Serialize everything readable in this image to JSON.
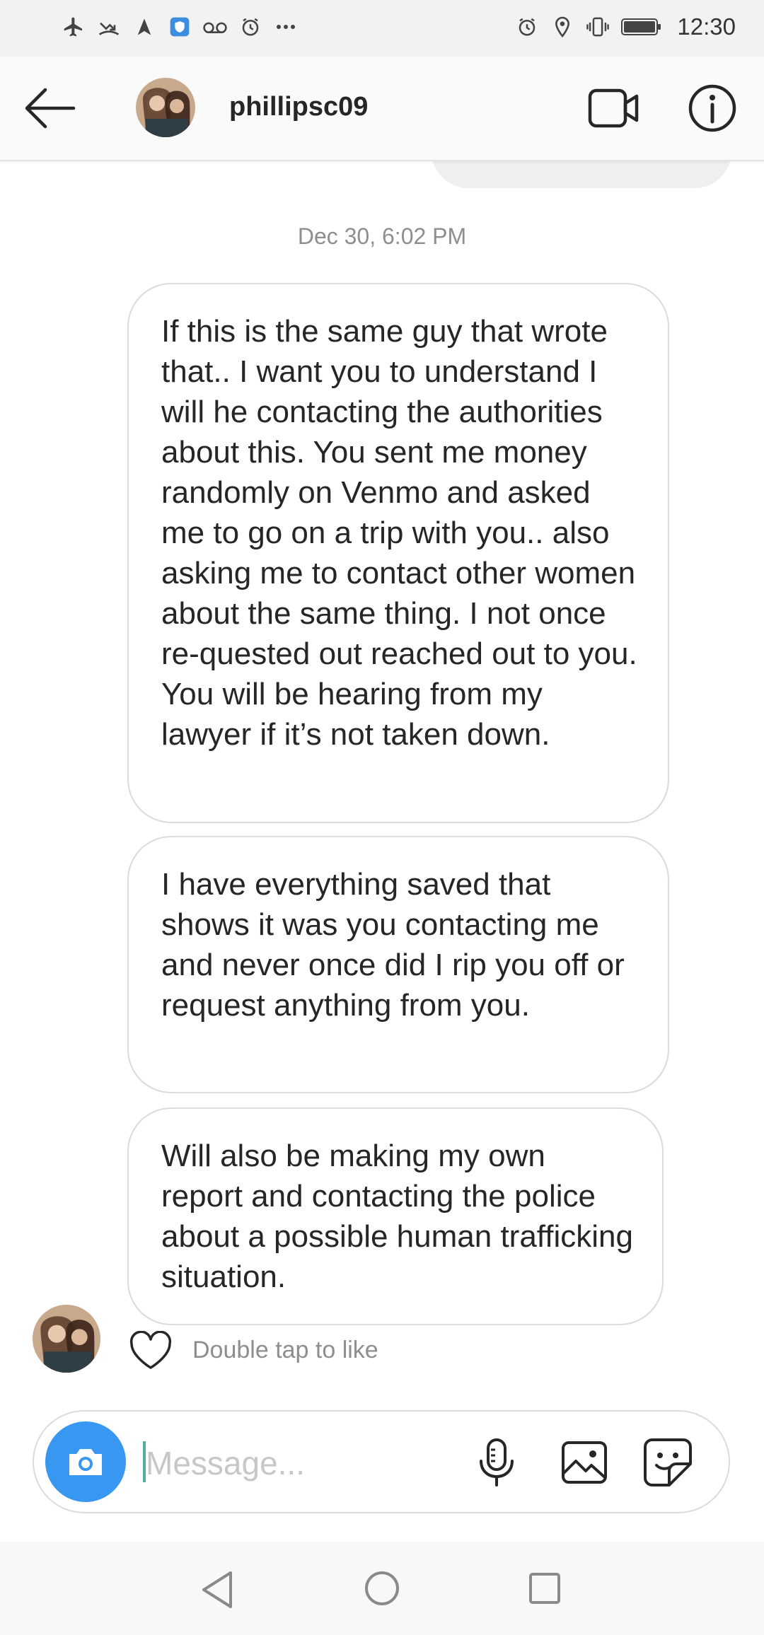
{
  "status_bar": {
    "time": "12:30",
    "left_icons": [
      "airplane-icon",
      "missed-call-icon",
      "navigation-icon",
      "shield-icon",
      "voicemail-icon",
      "alarm-icon",
      "more-icon"
    ],
    "right_icons": [
      "alarm-icon",
      "location-icon",
      "vibrate-icon",
      "battery-icon"
    ]
  },
  "header": {
    "username": "phillipsc09",
    "icons": [
      "back-arrow-icon",
      "video-call-icon",
      "info-icon"
    ]
  },
  "thread": {
    "timestamp": "Dec 30, 6:02 PM",
    "messages": [
      {
        "text": "If this is the same guy that wrote that.. I want you to understand I will he contacting the authorities about this. You sent me money randomly on Venmo and asked me to go on a trip with you.. also asking me to contact other women about the same thing. I not once re-quested out reached out to you. You will be hearing from my lawyer if it’s not taken down."
      },
      {
        "text": "I have everything saved that shows it was you contacting me and never once did I rip you off or request anything from you."
      },
      {
        "text": "Will also be making my own report and contacting the police about a possible human trafficking situation."
      }
    ],
    "like_hint": "Double tap to like"
  },
  "composer": {
    "placeholder": "Message...",
    "icons": [
      "camera-icon",
      "microphone-icon",
      "gallery-icon",
      "sticker-icon"
    ]
  },
  "colors": {
    "accent": "#3897f0",
    "bubble_border": "#dbdbdb",
    "muted_text": "#8e8e8e"
  }
}
